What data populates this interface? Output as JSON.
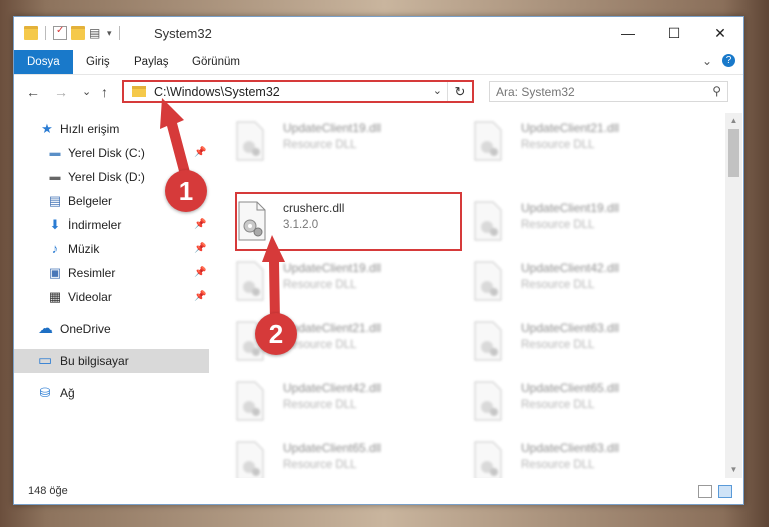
{
  "window": {
    "title": "System32",
    "minimize": "—",
    "maximize": "☐",
    "close": "✕"
  },
  "ribbon": {
    "tabs": [
      "Dosya",
      "Giriş",
      "Paylaş",
      "Görünüm"
    ],
    "collapse": "⌄",
    "help": "?"
  },
  "nav": {
    "back": "←",
    "forward": "→",
    "recent": "⌄",
    "up": "↑",
    "address": "C:\\Windows\\System32",
    "address_dropdown": "⌄",
    "refresh": "↻",
    "search_placeholder": "Ara: System32",
    "search_icon": "⚲"
  },
  "sidebar": {
    "items": [
      {
        "label": "Hızlı erişim",
        "icon": "star-icon",
        "glyph": "★",
        "color": "#2b7cd3"
      },
      {
        "label": "Yerel Disk (C:)",
        "icon": "drive-icon",
        "glyph": "▬",
        "color": "#5a8fc7",
        "pinned": true
      },
      {
        "label": "Yerel Disk (D:)",
        "icon": "drive-icon",
        "glyph": "▬",
        "color": "#666666"
      },
      {
        "label": "Belgeler",
        "icon": "document-icon",
        "glyph": "▤",
        "color": "#4a78b8"
      },
      {
        "label": "İndirmeler",
        "icon": "download-icon",
        "glyph": "⬇",
        "color": "#2b7cd3",
        "pinned": true
      },
      {
        "label": "Müzik",
        "icon": "music-icon",
        "glyph": "♪",
        "color": "#2b7cd3",
        "pinned": true
      },
      {
        "label": "Resimler",
        "icon": "pictures-icon",
        "glyph": "▣",
        "color": "#4a78b8",
        "pinned": true
      },
      {
        "label": "Videolar",
        "icon": "film-icon",
        "glyph": "▦",
        "color": "#333333",
        "pinned": true
      },
      {
        "label": "OneDrive",
        "icon": "cloud-icon",
        "glyph": "☁",
        "color": "#1e6fc4"
      },
      {
        "label": "Bu bilgisayar",
        "icon": "computer-icon",
        "glyph": "▭",
        "color": "#2b7cd3",
        "selected": true
      },
      {
        "label": "Ağ",
        "icon": "network-icon",
        "glyph": "⛁",
        "color": "#2b7cd3"
      }
    ],
    "pin_glyph": "📌"
  },
  "files": [
    {
      "name": "UpdateClient19.dll",
      "desc": "Resource DLL",
      "blurred": true
    },
    {
      "name": "UpdateClient21.dll",
      "desc": "Resource DLL",
      "blurred": true
    },
    {
      "name": "crusherc.dll",
      "desc": "3.1.2.0",
      "blurred": false
    },
    {
      "name": "UpdateClient19.dll",
      "desc": "Resource DLL",
      "blurred": true
    },
    {
      "name": "UpdateClient19.dll",
      "desc": "Resource DLL",
      "blurred": true
    },
    {
      "name": "UpdateClient42.dll",
      "desc": "Resource DLL",
      "blurred": true
    },
    {
      "name": "UpdateClient21.dll",
      "desc": "Resource DLL",
      "blurred": true
    },
    {
      "name": "UpdateClient63.dll",
      "desc": "Resource DLL",
      "blurred": true
    },
    {
      "name": "UpdateClient42.dll",
      "desc": "Resource DLL",
      "blurred": true
    },
    {
      "name": "UpdateClient65.dll",
      "desc": "Resource DLL",
      "blurred": true
    },
    {
      "name": "UpdateClient65.dll",
      "desc": "Resource DLL",
      "blurred": true
    },
    {
      "name": "UpdateClient63.dll",
      "desc": "Resource DLL",
      "blurred": true
    }
  ],
  "status": {
    "count": "148 öğe"
  },
  "markers": [
    "1",
    "2"
  ],
  "colors": {
    "accent": "#1979ca",
    "highlight": "#d63a3a"
  }
}
